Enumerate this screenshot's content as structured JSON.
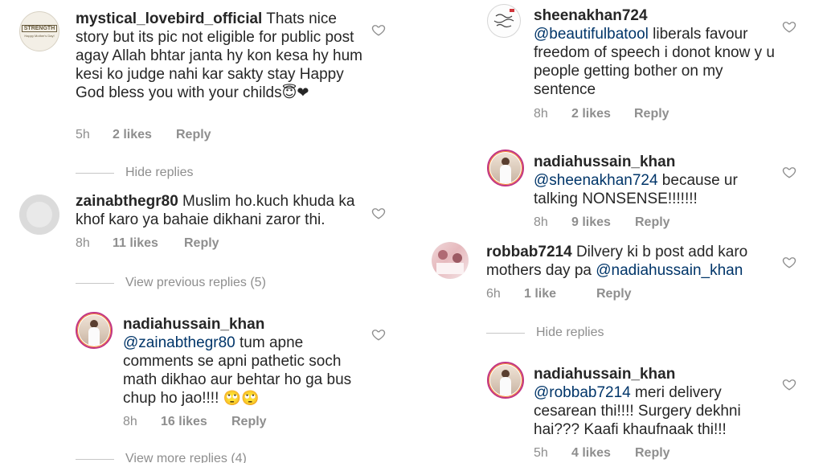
{
  "left": {
    "c1": {
      "username": "mystical_lovebird_official",
      "text": "Thats nice story but its pic not eligible for public post  agay Allah bhtar janta hy kon kesa hy hum kesi ko judge nahi kar sakty stay Happy God bless you with your childs",
      "emoji": "😇❤",
      "time": "5h",
      "likes": "2 likes",
      "reply": "Reply",
      "avatar_text": "STRENGTH",
      "avatar_sub": "Happy Mother's Day!"
    },
    "hide_replies": "Hide replies",
    "c2": {
      "username": "zainabthegr80",
      "text": "Muslim ho.kuch khuda ka khof karo ya bahaie dikhani zaror thi.",
      "time": "8h",
      "likes": "11 likes",
      "reply": "Reply"
    },
    "view_previous": "View previous replies (5)",
    "c3": {
      "username": "nadiahussain_khan",
      "mention": "@zainabthegr80",
      "text": " tum apne comments se apni pathetic soch math dikhao aur behtar ho ga bus chup ho jao!!!! ",
      "emoji": "🙄🙄",
      "time": "8h",
      "likes": "16 likes",
      "reply": "Reply"
    },
    "view_more": "View more replies (4)"
  },
  "right": {
    "c4": {
      "username": "sheenakhan724",
      "mention": "@beautifulbatool",
      "text": " liberals favour freedom of speech i donot know y u people getting bother on my sentence",
      "time": "8h",
      "likes": "2 likes",
      "reply": "Reply"
    },
    "c5": {
      "username": "nadiahussain_khan",
      "mention": "@sheenakhan724",
      "text": " because ur talking NONSENSE!!!!!!!",
      "time": "8h",
      "likes": "9 likes",
      "reply": "Reply"
    },
    "c6": {
      "username": "robbab7214",
      "text": "Dilvery ki b post add karo mothers day pa ",
      "mention": "@nadiahussain_khan",
      "time": "6h",
      "likes": "1 like",
      "reply": "Reply"
    },
    "hide_replies": "Hide replies",
    "c7": {
      "username": "nadiahussain_khan",
      "mention": "@robbab7214",
      "text": " meri delivery cesarean thi!!!! Surgery dekhni hai??? Kaafi khaufnaak thi!!!",
      "time": "5h",
      "likes": "4 likes",
      "reply": "Reply"
    }
  },
  "icons": {
    "like": "heart-outline-icon"
  },
  "colors": {
    "mention": "#003569",
    "meta": "#8e8e8e",
    "text": "#262626"
  }
}
